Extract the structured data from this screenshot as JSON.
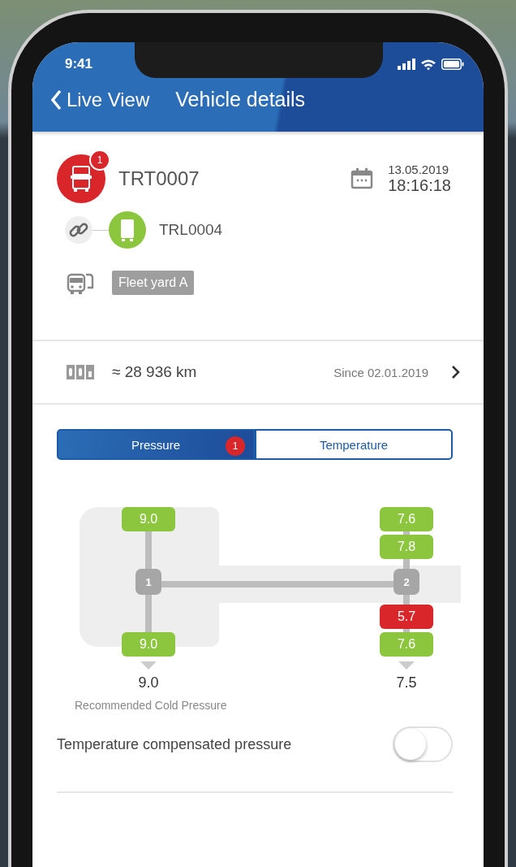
{
  "status_bar": {
    "time": "9:41"
  },
  "header": {
    "back_label": "Live View",
    "title": "Vehicle details"
  },
  "vehicle": {
    "id": "TRT0007",
    "alert_count": "1",
    "date": "13.05.2019",
    "time": "18:16:18"
  },
  "trailer": {
    "id": "TRL0004"
  },
  "group": {
    "label": "Fleet yard A"
  },
  "odometer": {
    "reading": "≈ 28 936 km",
    "since": "Since 02.01.2019"
  },
  "tabs": [
    {
      "label": "Pressure",
      "selected": true,
      "badge": "1"
    },
    {
      "label": "Temperature",
      "selected": false
    }
  ],
  "axles": [
    {
      "number": "1",
      "recommended": "9.0",
      "top": [
        {
          "value": "9.0",
          "alert": false
        }
      ],
      "bottom": [
        {
          "value": "9.0",
          "alert": false
        }
      ]
    },
    {
      "number": "2",
      "recommended": "7.5",
      "top": [
        {
          "value": "7.6",
          "alert": false
        },
        {
          "value": "7.8",
          "alert": false
        }
      ],
      "bottom": [
        {
          "value": "5.7",
          "alert": true
        },
        {
          "value": "7.6",
          "alert": false
        }
      ]
    }
  ],
  "recommended_label": "Recommended Cold Pressure",
  "compensation": {
    "label": "Temperature compensated pressure",
    "on": false
  }
}
